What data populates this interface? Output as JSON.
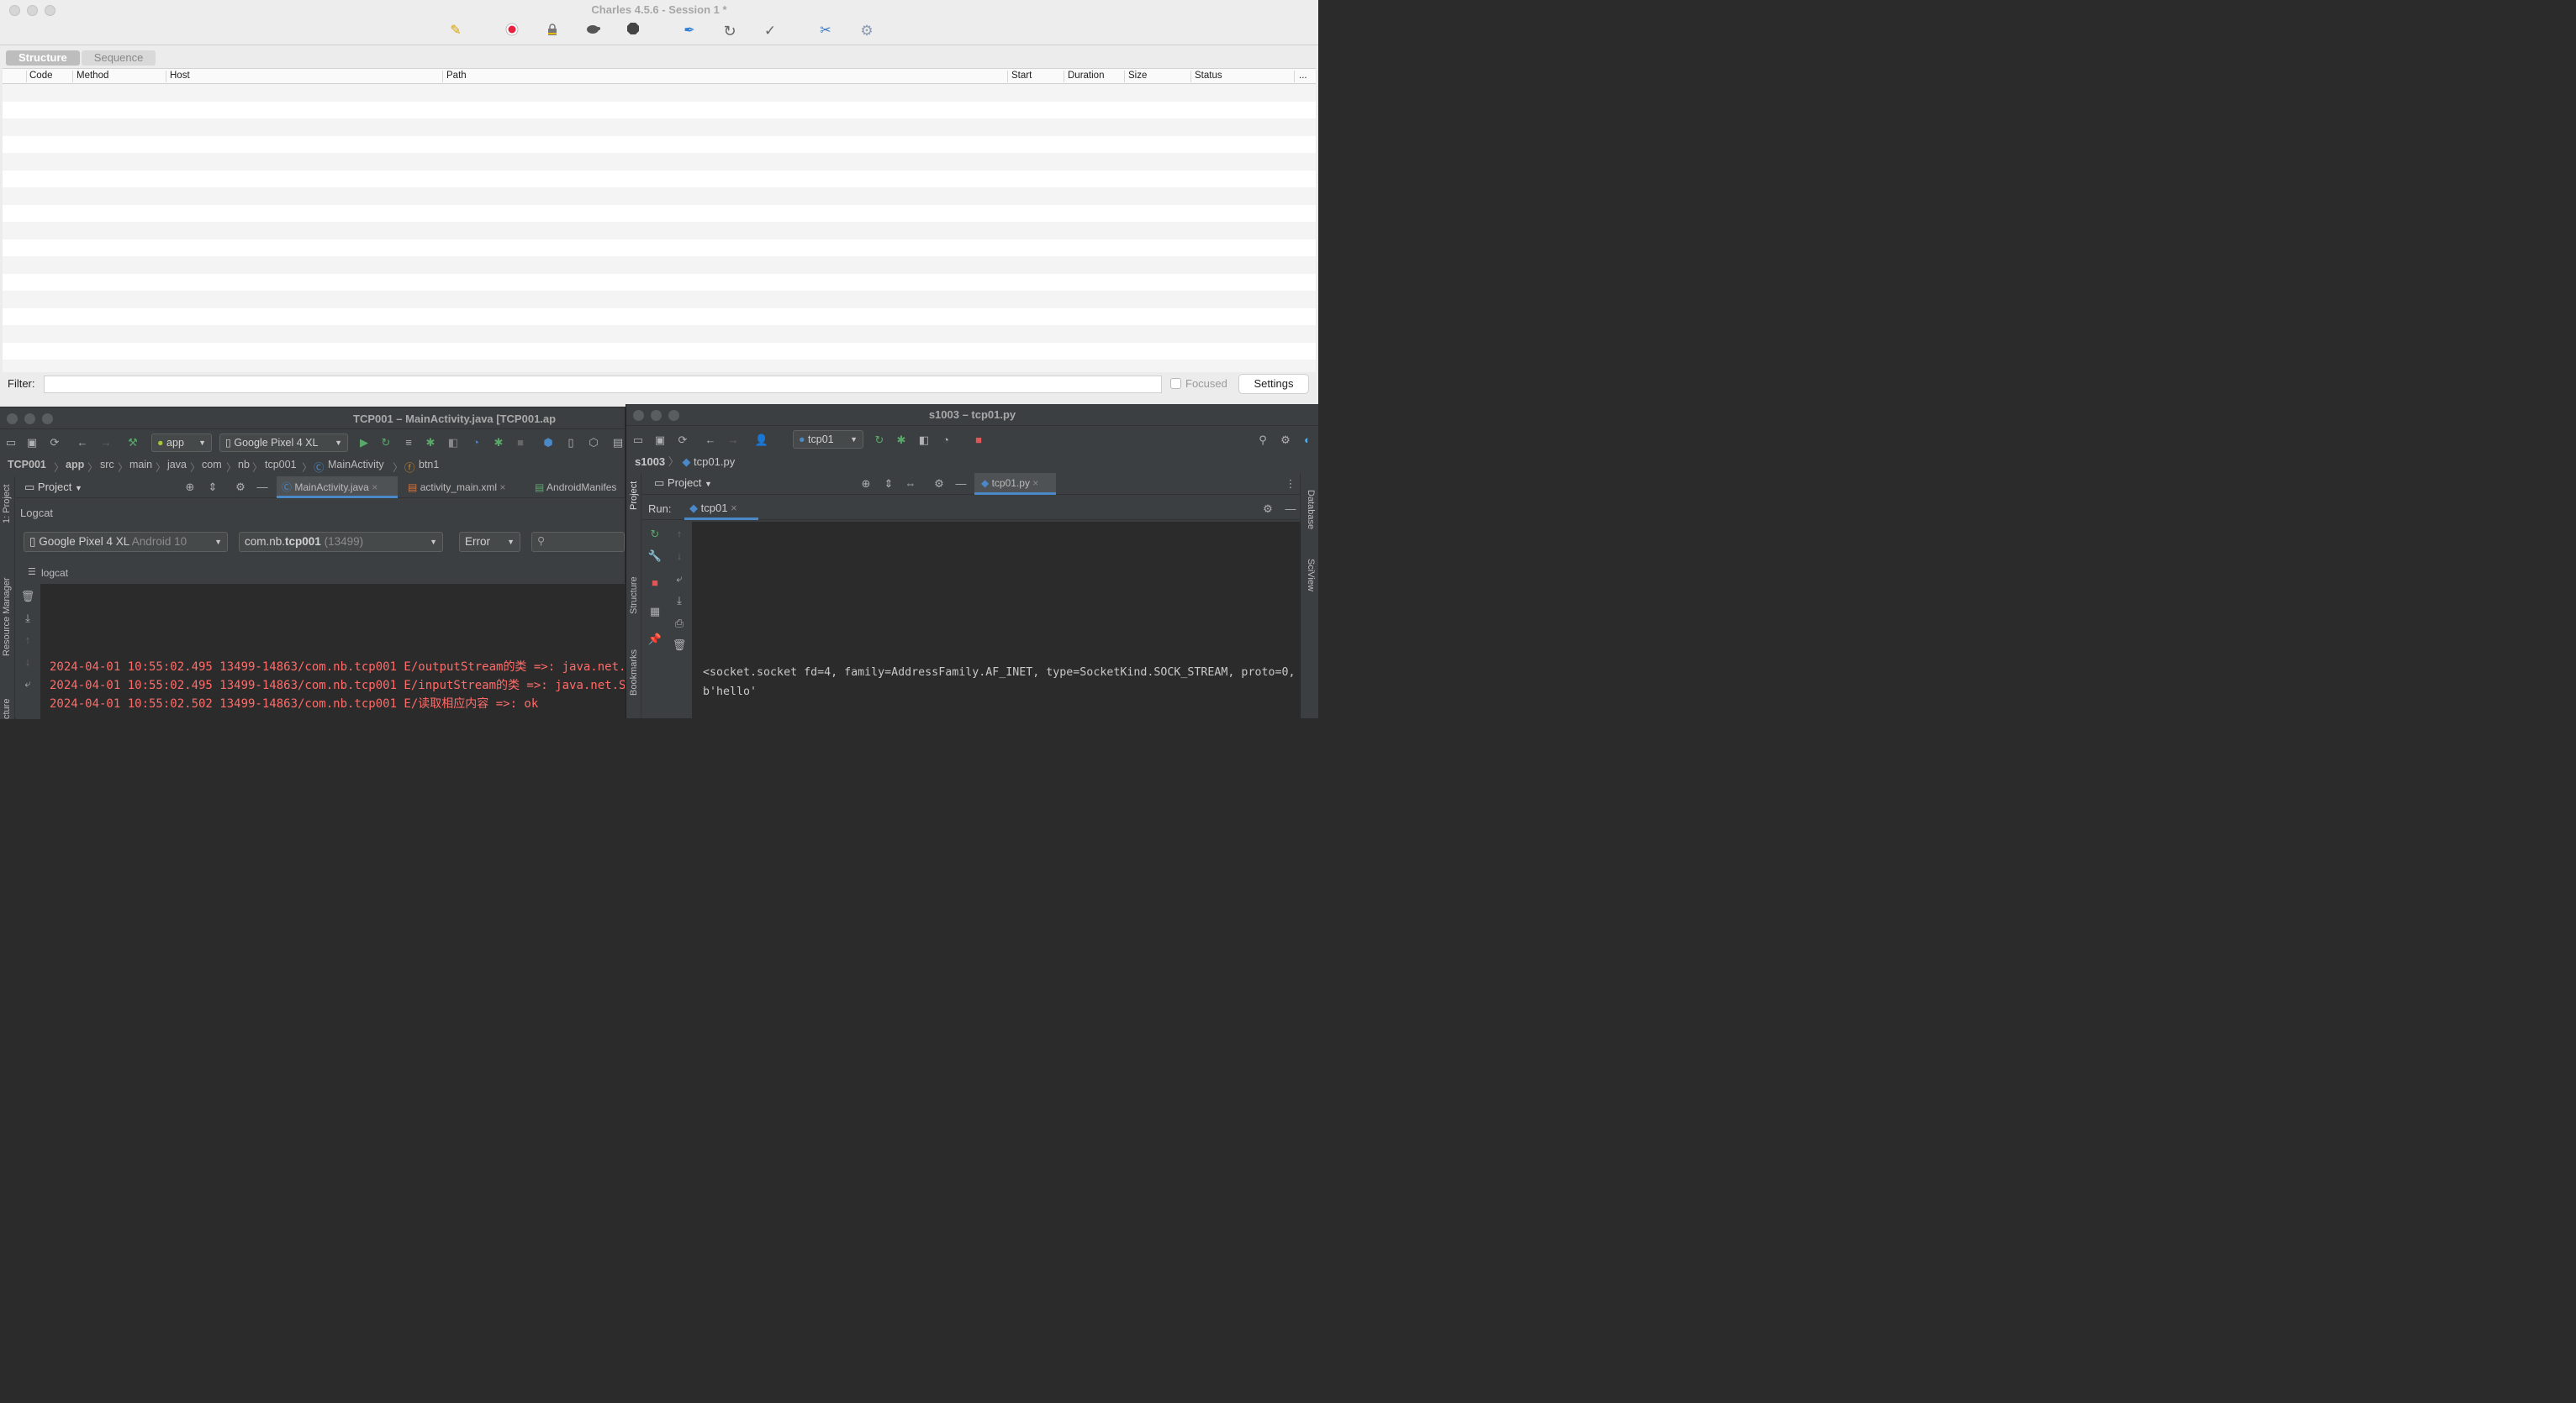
{
  "charles": {
    "title": "Charles 4.5.6 - Session 1 *",
    "tabs": [
      "Structure",
      "Sequence"
    ],
    "columns": [
      "Code",
      "Method",
      "Host",
      "Path",
      "Start",
      "Duration",
      "Size",
      "Status",
      "..."
    ],
    "filter_label": "Filter:",
    "focused_label": "Focused",
    "settings_label": "Settings",
    "toolbar_icons": [
      "broom-icon",
      "record-icon",
      "lock-icon",
      "turtle-icon",
      "stop-hexagon-icon",
      "pen-icon",
      "refresh-icon",
      "check-icon",
      "tools-icon",
      "gear-icon"
    ],
    "colors": {
      "record": "#e8213f",
      "broom": "#d9a400",
      "pen": "#2f7fd6"
    }
  },
  "android_studio": {
    "title": "TCP001 – MainActivity.java [TCP001.ap",
    "run_config": "app",
    "device": "Google Pixel 4 XL",
    "breadcrumb": [
      "TCP001",
      "app",
      "src",
      "main",
      "java",
      "com",
      "nb",
      "tcp001",
      "MainActivity",
      "btn1"
    ],
    "project_label": "Project",
    "editor_tabs": [
      "MainActivity.java",
      "activity_main.xml",
      "AndroidManifes"
    ],
    "side_tabs": [
      "1: Project",
      "Resource Manager",
      "cture"
    ],
    "logcat_title": "Logcat",
    "logcat_device": "Google Pixel 4 XL",
    "logcat_device_os": "Android 10",
    "logcat_process_prefix": "com.nb.",
    "logcat_process_bold": "tcp001",
    "logcat_process_pid": "(13499)",
    "logcat_level": "Error",
    "logcat_tab": "logcat",
    "log_lines": [
      "2024-04-01 10:55:02.495 13499-14863/com.nb.tcp001 E/outputStream的类 =>: java.net.Soc",
      "2024-04-01 10:55:02.495 13499-14863/com.nb.tcp001 E/inputStream的类 =>: java.net.Soc",
      "2024-04-01 10:55:02.502 13499-14863/com.nb.tcp001 E/读取相应内容 =>: ok"
    ],
    "log_color": "#ff6b68"
  },
  "pycharm": {
    "title": "s1003 – tcp01.py",
    "run_config": "tcp01",
    "breadcrumb_root": "s1003",
    "breadcrumb_file": "tcp01.py",
    "project_label": "Project",
    "editor_tab": "tcp01.py",
    "run_label": "Run:",
    "run_tab": "tcp01",
    "side_tabs_left": [
      "Project",
      "Structure",
      "Bookmarks"
    ],
    "side_tabs_right": [
      "Database",
      "SciView"
    ],
    "output_lines": [
      "<socket.socket fd=4, family=AddressFamily.AF_INET, type=SocketKind.SOCK_STREAM, proto=0, ",
      "b'hello'"
    ]
  }
}
